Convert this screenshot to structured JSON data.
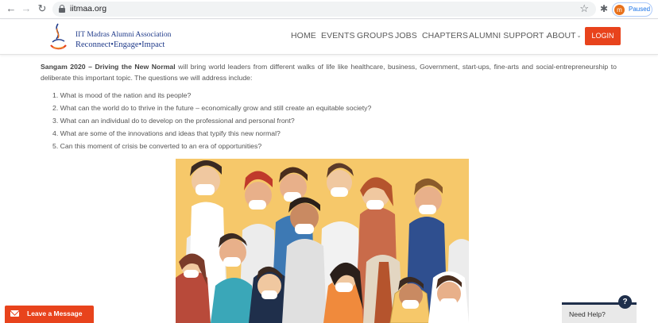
{
  "browser": {
    "url": "iitmaa.org",
    "profile_initial": "m",
    "profile_status": "Paused",
    "back_glyph": "←",
    "forward_glyph": "→",
    "reload_glyph": "↻",
    "star_glyph": "☆",
    "extensions_glyph": "✱",
    "icons": [
      "back-arrow-icon",
      "forward-arrow-icon",
      "reload-icon",
      "lock-icon",
      "star-icon",
      "extensions-icon"
    ]
  },
  "site": {
    "logo_line1": "IIT Madras Alumni Association",
    "logo_line2": "Reconnect•Engage•Impact",
    "nav": {
      "home": "HOME",
      "events": "EVENTS",
      "groups": "GROUPS",
      "jobs": "JOBS",
      "chapters": "CHAPTERS",
      "alumni_support": "ALUMNI SUPPORT",
      "about": "ABOUT",
      "caret": "⌄"
    },
    "login": "LOGIN",
    "colors": {
      "accent": "#e8431c",
      "brand": "#1f3a8a",
      "help_navy": "#1f2f4b"
    }
  },
  "content": {
    "intro_bold": "Sangam 2020 – Driving the New Normal",
    "intro_rest": " will bring world leaders from different walks of life like healthcare, business, Government, start-ups, fine-arts and social-entrepreneurship to deliberate this important topic. The questions we will address include:",
    "questions": [
      "1. What is mood of the nation and its people?",
      "2. What can the world do to thrive in the future – economically grow and still create an equitable society?",
      "3. What can an individual do to develop on the professional and personal front?",
      "4. What are some of the innovations and ideas that typify this new normal?",
      "5. Can this moment of crisis be converted to an era of opportunities?"
    ]
  },
  "widgets": {
    "leave_message": "Leave a Message",
    "need_help": "Need Help?",
    "help_badge": "?"
  }
}
